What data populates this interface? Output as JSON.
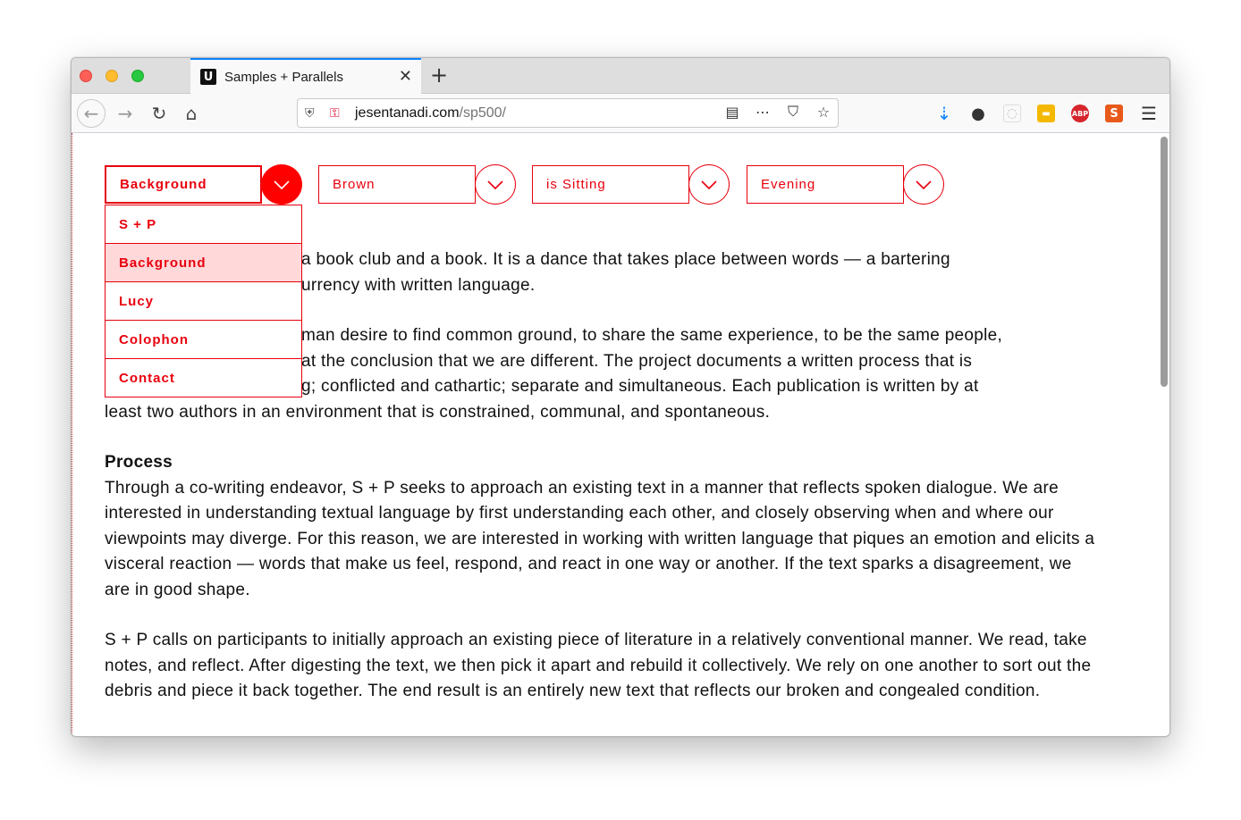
{
  "browser": {
    "tab_title": "Samples + Parallels",
    "tab_close": "✕",
    "new_tab": "+",
    "url_domain": "jesentanadi.com",
    "url_path": "/sp500/",
    "icons": [
      "back-icon",
      "forward-icon",
      "reload-icon",
      "home-icon",
      "shield-icon",
      "insecure-lock-icon",
      "reader-icon",
      "more-icon",
      "pocket-icon",
      "bookmark-star-icon",
      "download-icon",
      "account-icon",
      "extension-icon",
      "abp-icon",
      "menu-icon"
    ],
    "abp_label": "ABP",
    "ext3_label": "S"
  },
  "selectors": [
    {
      "label": "Background",
      "open": true
    },
    {
      "label": "Brown",
      "open": false
    },
    {
      "label": "is Sitting",
      "open": false
    },
    {
      "label": "Evening",
      "open": false
    }
  ],
  "dropdown": {
    "items": [
      "S + P",
      "Background",
      "Lucy",
      "Colophon",
      "Contact"
    ],
    "selected": "Background"
  },
  "content": {
    "para1": "a book club and a book. It is a dance that takes place between words — a bartering",
    "para1b": "urrency with written language.",
    "para2a": "man desire to find common ground, to share the same experience, to be the same people,",
    "para2b": "at the conclusion that we are different. The project documents a written process that is",
    "para2c": "g; conflicted and cathartic; separate and simultaneous. Each publication is written by at",
    "para2d": "least two authors in an environment that is constrained, communal, and spontaneous.",
    "process_heading": "Process",
    "process_text": "Through a co-writing endeavor, S + P seeks to approach an existing text in a manner that reflects spoken dialogue. We are interested in understanding textual language by first understanding each other, and closely observing when and where our viewpoints may diverge. For this reason, we are interested in working with written language that piques an emotion and elicits a visceral reaction — words that make us feel, respond, and react in one way or another. If the text sparks a disagreement, we are in good shape.",
    "para4": "S + P calls on participants to initially approach an existing piece of literature in a relatively conventional manner. We read, take notes, and reflect. After digesting the text, we then pick it apart and rebuild it collectively. We rely on one another to sort out the debris and piece it back together. The end result is an entirely new text that reflects our broken and congealed condition."
  },
  "colors": {
    "accent": "#e8000d",
    "selected_bg": "#ffd8da",
    "text_brown": "#9a6a2e"
  }
}
